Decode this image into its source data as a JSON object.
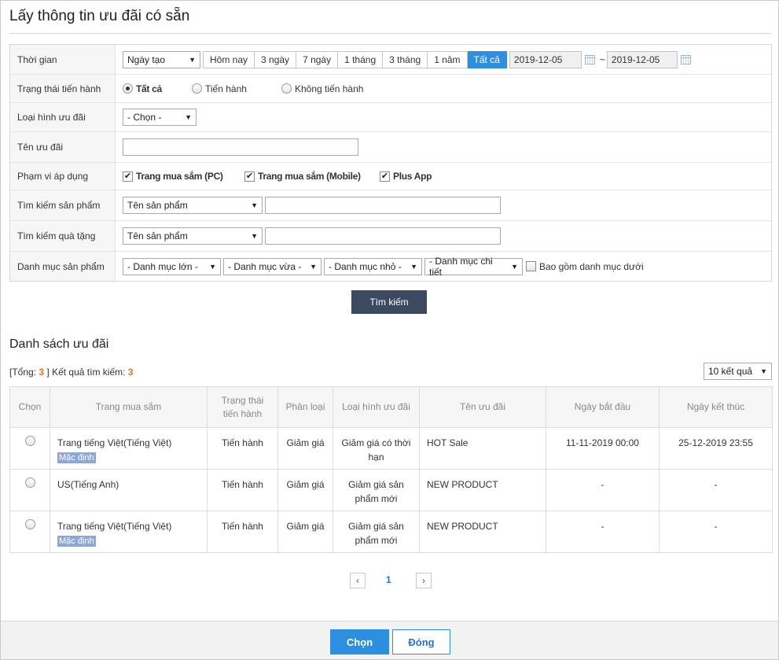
{
  "title": "Lấy thông tin ưu đãi có sẵn",
  "filters": {
    "time": {
      "label": "Thời gian",
      "type_select": "Ngày tạo",
      "ranges": [
        "Hôm nay",
        "3 ngày",
        "7 ngày",
        "1 tháng",
        "3 tháng",
        "1 năm",
        "Tất cả"
      ],
      "active_range": "Tất cả",
      "date_from": "2019-12-05",
      "separator": "~",
      "date_to": "2019-12-05"
    },
    "status": {
      "label": "Trạng thái tiến hành",
      "options": [
        "Tất cả",
        "Tiến hành",
        "Không tiến hành"
      ],
      "selected": "Tất cả"
    },
    "promo_type": {
      "label": "Loại hình ưu đãi",
      "select": "- Chọn -"
    },
    "promo_name": {
      "label": "Tên ưu đãi",
      "value": ""
    },
    "scope": {
      "label": "Phạm vi áp dụng",
      "options": [
        "Trang mua sắm (PC)",
        "Trang mua sắm (Mobile)",
        "Plus App"
      ],
      "checked": [
        true,
        true,
        true
      ]
    },
    "product_search": {
      "label": "Tìm kiếm sản phẩm",
      "select": "Tên sản phẩm",
      "value": ""
    },
    "gift_search": {
      "label": "Tìm kiếm quà tặng",
      "select": "Tên sản phẩm",
      "value": ""
    },
    "category": {
      "label": "Danh mục sản phẩm",
      "selects": [
        "- Danh mục lớn -",
        "- Danh mục vừa -",
        "- Danh mục nhỏ -",
        "- Danh mục chi tiết"
      ],
      "include_sub_label": "Bao gồm danh mục dưới",
      "include_sub": false
    }
  },
  "search_button": "Tìm kiếm",
  "list": {
    "title": "Danh sách ưu đãi",
    "summary_prefix": "[Tổng:",
    "total": "3",
    "summary_mid": "] Kết quả tìm kiếm:",
    "result_count": "3",
    "per_page": "10 kết quả",
    "columns": [
      "Chọn",
      "Trang mua sắm",
      "Trạng thái tiến hành",
      "Phân loại",
      "Loại hình ưu đãi",
      "Tên ưu đãi",
      "Ngày bắt đầu",
      "Ngày kết thúc"
    ],
    "rows": [
      {
        "shop": "Trang tiếng Việt(Tiếng Việt)",
        "badge": "Mặc định",
        "status": "Tiến hành",
        "category": "Giảm giá",
        "promo_type": "Giảm giá có thời hạn",
        "name": "HOT Sale",
        "start": "11-11-2019 00:00",
        "end": "25-12-2019 23:55"
      },
      {
        "shop": "US(Tiếng Anh)",
        "badge": "",
        "status": "Tiến hành",
        "category": "Giảm giá",
        "promo_type": "Giảm giá sản phẩm mới",
        "name": "NEW PRODUCT",
        "start": "-",
        "end": "-"
      },
      {
        "shop": "Trang tiếng Việt(Tiếng Việt)",
        "badge": "Mặc định",
        "status": "Tiến hành",
        "category": "Giảm giá",
        "promo_type": "Giảm giá sản phẩm mới",
        "name": "NEW PRODUCT",
        "start": "-",
        "end": "-"
      }
    ]
  },
  "pagination": {
    "current": "1",
    "prev_icon": "‹",
    "next_icon": "›"
  },
  "footer": {
    "select_button": "Chọn",
    "close_button": "Đóng"
  },
  "colors": {
    "accent": "#2d8fe0",
    "search_button": "#3b4961",
    "count_highlight": "#e2721c",
    "badge": "#8aa7d6"
  }
}
